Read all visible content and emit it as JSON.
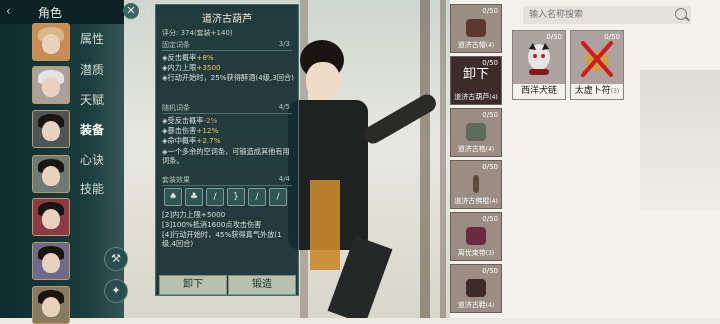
{
  "nav": {
    "title": "角色",
    "items": [
      {
        "label": "属性"
      },
      {
        "label": "潜质"
      },
      {
        "label": "天赋"
      },
      {
        "label": "装备"
      },
      {
        "label": "心诀"
      },
      {
        "label": "技能"
      }
    ]
  },
  "panel": {
    "title": "道济古葫芦",
    "score": "评分: 374(套装+140)",
    "fixed": {
      "title": "固定词条",
      "count": "3/3",
      "lines": [
        {
          "text": "反击概率",
          "value": "+8%"
        },
        {
          "text": "内力上限",
          "value": "+3500"
        },
        {
          "text": "行动开始时，25%获得醉酒(4级,3回合)",
          "value": ""
        }
      ]
    },
    "random": {
      "title": "随机词条",
      "count": "4/5",
      "lines": [
        {
          "text": "受反击概率",
          "value": "-2%"
        },
        {
          "text": "暴击伤害",
          "value": "+12%"
        },
        {
          "text": "命中概率",
          "value": "+2.7%"
        },
        {
          "text": "一个多余的空词条，可锻造成其他有用词条。",
          "value": ""
        }
      ]
    },
    "set": {
      "title": "套装效果",
      "count": "4/4",
      "lines": [
        {
          "text": "[2]内力上限+5000"
        },
        {
          "text": "[3]100%抵消1600点攻击伤害"
        },
        {
          "text": "[4]行动开始时，45%获得真气外放(1级,4回合)"
        }
      ]
    },
    "unequip_label": "卸下",
    "forge_label": "锻造"
  },
  "equipped": [
    {
      "count": "0/50",
      "name": "道济古帽",
      "num": "(4)"
    },
    {
      "count": "0/50",
      "name": "道济古葫芦",
      "num": "(4)",
      "action": "卸下"
    },
    {
      "count": "0/50",
      "name": "道济古袍",
      "num": "(4)"
    },
    {
      "count": "0/50",
      "name": "道济古佛棍",
      "num": "(4)"
    },
    {
      "count": "0/50",
      "name": "离忧束带",
      "num": "(3)"
    },
    {
      "count": "0/50",
      "name": "道济古鞋",
      "num": "(4)"
    }
  ],
  "search": {
    "placeholder": "输入名称搜索"
  },
  "inventory": [
    {
      "count": "0/50",
      "name": "西洋犬链",
      "num": ""
    },
    {
      "count": "0/50",
      "name": "太虚卜符",
      "num": "(3)"
    }
  ]
}
